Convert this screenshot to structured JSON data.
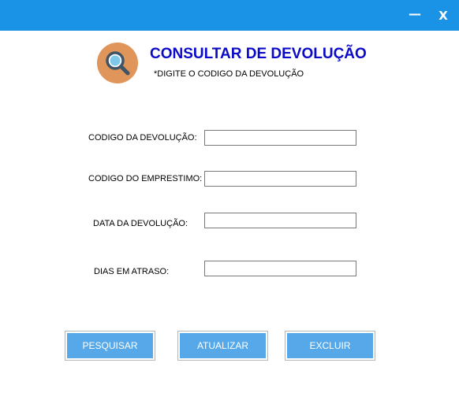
{
  "window": {
    "minimize_label": "—",
    "close_label": "X"
  },
  "header": {
    "title": "CONSULTAR DE DEVOLUÇÃO",
    "subtitle": "*DIGITE O CODIGO DA DEVOLUÇÃO",
    "logo_icon": "search-magnifier-icon"
  },
  "form": {
    "fields": [
      {
        "label": "CODIGO DA DEVOLUÇÃO:",
        "value": ""
      },
      {
        "label": "CODIGO DO EMPRESTIMO:",
        "value": ""
      },
      {
        "label": "DATA DA DEVOLUÇÃO:",
        "value": ""
      },
      {
        "label": "DIAS EM ATRASO:",
        "value": ""
      }
    ]
  },
  "buttons": {
    "search_label": "PESQUISAR",
    "update_label": "ATUALIZAR",
    "delete_label": "EXCLUIR"
  },
  "colors": {
    "titlebar": "#1a92e5",
    "title_text": "#0a0ac8",
    "button": "#56a8e8",
    "logo_circle": "#e0955a"
  }
}
